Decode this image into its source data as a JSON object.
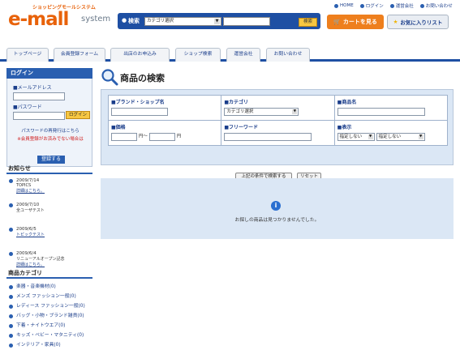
{
  "header": {
    "tagline": "ショッピングモールシステム",
    "logo": "e-mall",
    "logo_sub": "system",
    "top_links": [
      "HOME",
      "ログイン",
      "運営会社",
      "お問い合わせ"
    ],
    "search_label": "検索",
    "category_selected": "カテゴリ選択",
    "search_button": "検索",
    "cart_button": "カートを見る",
    "fav_button": "お気に入りリスト"
  },
  "nav": {
    "tabs": [
      "トップページ",
      "会員登録フォーム",
      "出店のお申込み",
      "ショップ検索",
      "運営会社",
      "お問い合わせ"
    ]
  },
  "login": {
    "title": "ログイン",
    "email_label": "■メールアドレス",
    "password_label": "■パスワード",
    "login_button": "ログイン",
    "reissue_link": "パスワードの再発行はこちら",
    "note": "※会員登録がお済みでない場合は",
    "register_button": "登録する"
  },
  "news": {
    "title": "お知らせ",
    "items": [
      {
        "date": "2009/7/14",
        "text": "TOPICS",
        "link": "詳細はこちら。"
      },
      {
        "date": "2009/7/10",
        "text": "全ユーザテスト",
        "link": ""
      },
      {
        "date": "2009/6/5",
        "text": "",
        "link": "トピックテスト"
      },
      {
        "date": "2009/6/4",
        "text": "リニューアルオープン記念",
        "link": "詳細はこちら。"
      }
    ]
  },
  "categories": {
    "title": "商品カテゴリ",
    "items": [
      "楽器・音楽機材(0)",
      "メンズ ファッション一般(0)",
      "レディース ファッション一般(0)",
      "バッグ・小物・ブランド雑貨(0)",
      "下着・ナイトウエア(0)",
      "キッズ・ベビー・マタニティ(0)",
      "インテリア・家具(0)"
    ]
  },
  "main": {
    "page_title": "商品の検索",
    "fields": {
      "brand": "■ブランド・ショップ名",
      "category": "■カテゴリ",
      "category_selected": "カテゴリ選択",
      "product_name": "■商品名",
      "price": "■価格",
      "price_unit_from": "円〜",
      "price_unit_to": "円",
      "free_word": "■フリーワード",
      "display": "■表示",
      "display_opt1": "指定しない",
      "display_opt2": "指定しない"
    },
    "search_button": "上記の条件で検索する",
    "reset_button": "リセット",
    "no_result": "お探しの商品は見つかりませんでした。"
  },
  "colors": {
    "accent": "#1e4fa3",
    "orange": "#e8620a",
    "panel": "#dbe7f5"
  }
}
